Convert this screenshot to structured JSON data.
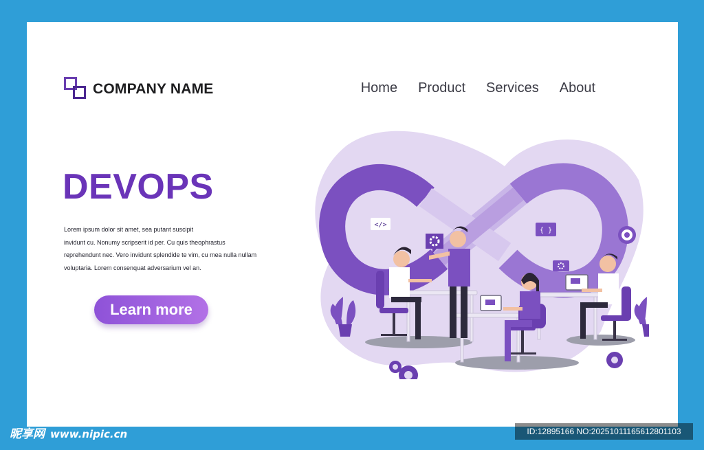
{
  "brand": {
    "name": "COMPANY NAME",
    "logo_icon": "overlapping-squares-icon"
  },
  "nav": {
    "items": [
      "Home",
      "Product",
      "Services",
      "About"
    ]
  },
  "hero": {
    "title": "DEVOPS",
    "body_lines": [
      "Lorem ipsum dolor sit amet, sea putant suscipit",
      "invidunt cu. Nonumy scripserit id per. Cu quis theophrastus",
      "reprehendunt nec. Vero invidunt splendide te vim, cu mea nulla nullam",
      "voluptaria. Lorem consenquat adversarium vel an."
    ],
    "cta_label": "Learn more"
  },
  "illustration": {
    "code_badge": "</>",
    "braces_badge": "{ }",
    "icons": [
      "infinity-loop-icon",
      "gear-icon",
      "target-icon",
      "plant-icon"
    ]
  },
  "watermark": {
    "site": "昵享网",
    "url": "www.nipic.cn",
    "id_text": "ID:12895166 NO:20251011165612801103"
  },
  "colors": {
    "frame": "#2f9ed7",
    "accent": "#6a34b8",
    "button_start": "#8e52d8",
    "button_end": "#b271e6",
    "illustration_bg": "#e2d6f1"
  }
}
